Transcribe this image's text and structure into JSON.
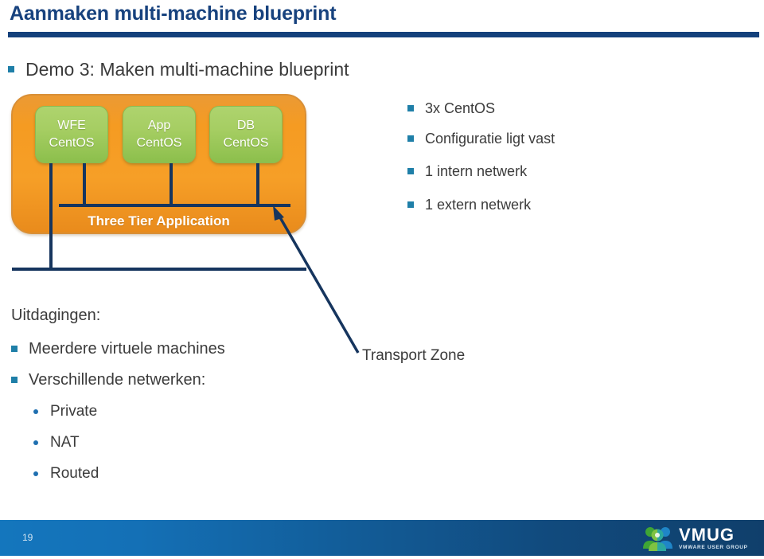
{
  "slide": {
    "title": "Aanmaken multi-machine blueprint",
    "page_number": "19",
    "accent_navy": "#14417c",
    "accent_blue": "#1f7fa8",
    "orange": "#f59b22",
    "green": "#a6ce63",
    "line_navy": "#16355e"
  },
  "demo_bullet": {
    "label": "Demo 3: Maken multi-machine blueprint"
  },
  "diagram": {
    "container_label": "Three Tier Application",
    "arrow_target_label": "Transport Zone",
    "machines": [
      {
        "role": "WFE",
        "os": "CentOS"
      },
      {
        "role": "App",
        "os": "CentOS"
      },
      {
        "role": "DB",
        "os": "CentOS"
      }
    ]
  },
  "right_bullets": [
    {
      "label": "3x CentOS"
    },
    {
      "label": "Configuratie ligt vast"
    },
    {
      "label": "1 intern netwerk"
    },
    {
      "label": "1 extern netwerk"
    }
  ],
  "challenges": {
    "heading": "Uitdagingen:",
    "items": [
      {
        "label": "Meerdere virtuele machines"
      },
      {
        "label": "Verschillende netwerken:"
      }
    ],
    "network_types": [
      {
        "label": "Private"
      },
      {
        "label": "NAT"
      },
      {
        "label": "Routed"
      }
    ]
  },
  "footer": {
    "logo_name": "VMUG",
    "logo_tagline": "VMWARE USER GROUP"
  }
}
